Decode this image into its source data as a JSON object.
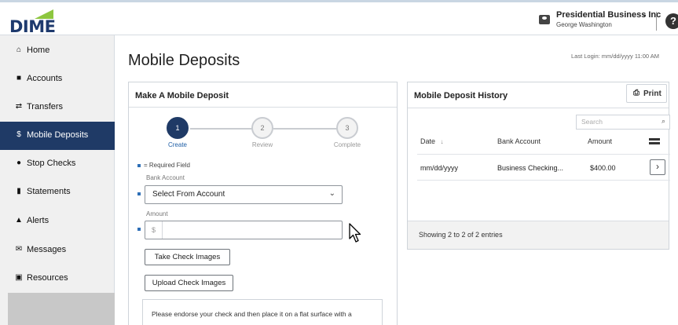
{
  "header": {
    "logo_text": "DIME",
    "account_name": "Presidential Business Inc",
    "account_user": "George Washington",
    "help_glyph": "?",
    "colors": {
      "brand_navy": "#1f3a66",
      "logo_green": "#8dc63f"
    }
  },
  "sidebar": {
    "items": [
      {
        "label": "Home",
        "icon": "home-icon",
        "glyph": "⌂"
      },
      {
        "label": "Accounts",
        "icon": "accounts-icon",
        "glyph": "■"
      },
      {
        "label": "Transfers",
        "icon": "transfers-icon",
        "glyph": "⇄"
      },
      {
        "label": "Mobile Deposits",
        "icon": "dollar-icon",
        "glyph": "$",
        "active": true
      },
      {
        "label": "Stop Checks",
        "icon": "stop-icon",
        "glyph": "●"
      },
      {
        "label": "Statements",
        "icon": "statements-icon",
        "glyph": "▮"
      },
      {
        "label": "Alerts",
        "icon": "bell-icon",
        "glyph": "▲"
      },
      {
        "label": "Messages",
        "icon": "envelope-icon",
        "glyph": "✉"
      },
      {
        "label": "Resources",
        "icon": "resources-icon",
        "glyph": "▣"
      }
    ]
  },
  "main": {
    "title": "Mobile Deposits",
    "last_login": "Last Login: mm/dd/yyyy  11:00 AM"
  },
  "deposit_form": {
    "title": "Make A Mobile Deposit",
    "steps": [
      {
        "number": "1",
        "label": "Create",
        "active": true
      },
      {
        "number": "2",
        "label": "Review",
        "active": false
      },
      {
        "number": "3",
        "label": "Complete",
        "active": false
      }
    ],
    "required_legend": "= Required Field",
    "bank_account_label": "Bank Account",
    "bank_account_value": "Select From Account",
    "amount_label": "Amount",
    "amount_prefix": "$",
    "amount_value": "",
    "take_images_label": "Take Check Images",
    "upload_images_label": "Upload Check Images",
    "instructions": "Please endorse your check and then place it on a flat surface with a"
  },
  "history": {
    "title": "Mobile Deposit History",
    "print_label": "Print",
    "search_placeholder": "Search",
    "columns": {
      "date": "Date",
      "bank_account": "Bank Account",
      "amount": "Amount"
    },
    "rows": [
      {
        "date": "mm/dd/yyyy",
        "bank_account": "Business Checking...",
        "amount": "$400.00"
      }
    ],
    "footer": "Showing 2 to 2 of 2 entries"
  }
}
